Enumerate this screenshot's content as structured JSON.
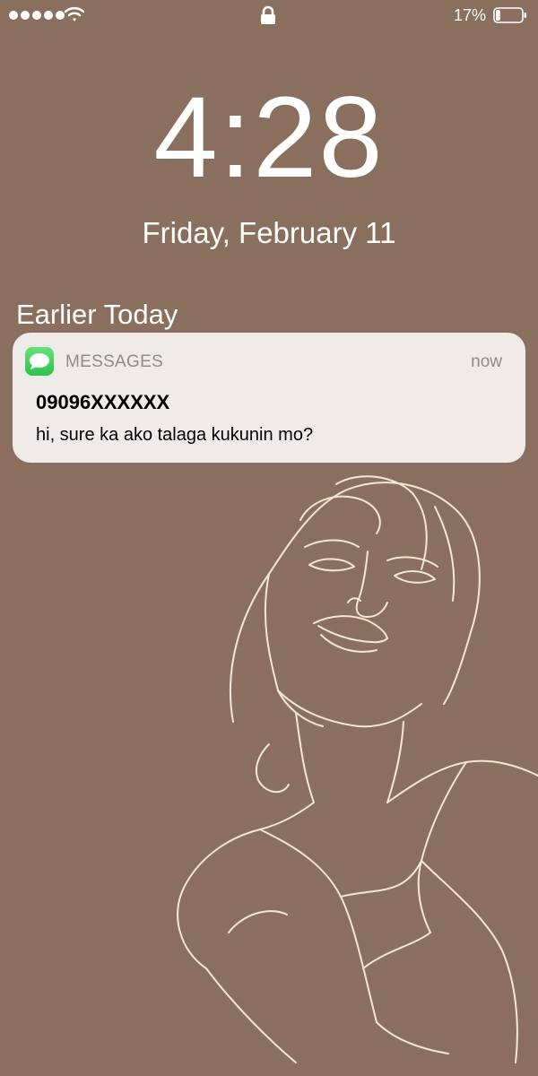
{
  "status_bar": {
    "signal_icon": "signal-dots-icon",
    "wifi_icon": "wifi-icon",
    "lock_icon": "lock-icon",
    "battery_percent": "17%",
    "battery_icon": "battery-icon",
    "battery_level": 0.17
  },
  "lock_screen": {
    "time": "4:28",
    "date": "Friday, February 11",
    "section_title": "Earlier Today"
  },
  "notification": {
    "app_icon": "messages-icon",
    "app_name": "MESSAGES",
    "timestamp": "now",
    "sender": "09096XXXXXX",
    "message": "hi, sure ka ako talaga kukunin mo?"
  },
  "colors": {
    "background": "#8b6f5e",
    "card": "#eeebe8",
    "accent_green": "#34c759",
    "line_art": "#f3e6d8"
  }
}
